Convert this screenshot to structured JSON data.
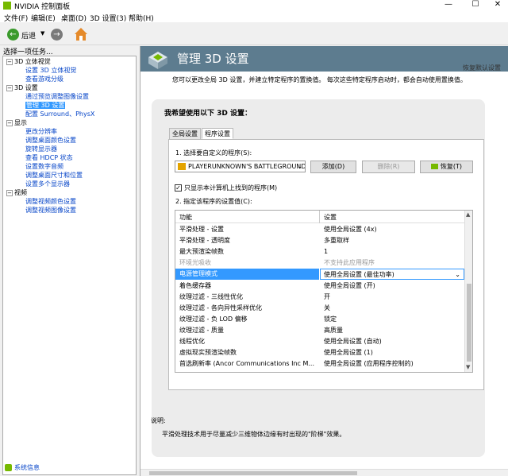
{
  "window": {
    "title": "NVIDIA 控制面板",
    "min": "—",
    "max": "☐",
    "close": "✕"
  },
  "menu": [
    "文件(F)",
    "编辑(E)",
    "桌面(D)",
    "3D 设置(3)",
    "帮助(H)"
  ],
  "toolbar": {
    "back_label": "后退",
    "back_icon": "back-arrow-icon",
    "forward_icon": "forward-arrow-icon",
    "home_icon": "home-icon"
  },
  "left": {
    "label": "选择一项任务...",
    "tree": [
      {
        "type": "cat",
        "label": "3D 立体视觉"
      },
      {
        "type": "link",
        "label": "设置 3D 立体视觉"
      },
      {
        "type": "link",
        "label": "查看游戏分级"
      },
      {
        "type": "cat",
        "label": "3D 设置"
      },
      {
        "type": "link",
        "label": "通过预览调整图像设置"
      },
      {
        "type": "sel",
        "label": "管理 3D 设置"
      },
      {
        "type": "link",
        "label": "配置 Surround、PhysX"
      },
      {
        "type": "cat",
        "label": "显示"
      },
      {
        "type": "link",
        "label": "更改分辨率"
      },
      {
        "type": "link",
        "label": "调整桌面颜色设置"
      },
      {
        "type": "link",
        "label": "旋转显示器"
      },
      {
        "type": "link",
        "label": "查看 HDCP 状态"
      },
      {
        "type": "link",
        "label": "设置数字音频"
      },
      {
        "type": "link",
        "label": "调整桌面尺寸和位置"
      },
      {
        "type": "link",
        "label": "设置多个显示器"
      },
      {
        "type": "cat",
        "label": "视频"
      },
      {
        "type": "link",
        "label": "调整视频颜色设置"
      },
      {
        "type": "link",
        "label": "调整视频图像设置"
      }
    ],
    "sysinfo": "系统信息"
  },
  "main": {
    "title": "管理 3D 设置",
    "restore_link": "恢复默认设置",
    "intro": "您可以更改全局 3D 设置，并建立特定程序的置换值。 每次这些特定程序启动时，都会自动使用置换值。",
    "panel_title": "我希望使用以下 3D 设置：",
    "tabs": [
      "全局设置",
      "程序设置"
    ],
    "step1": "1. 选择要自定义的程序(S):",
    "program": "PLAYERUNKNOWN'S BATTLEGROUNDS",
    "add_btn": "添加(D)",
    "del_btn": "删除(R)",
    "restore_btn": "恢复(T)",
    "checkbox_label": "只显示本计算机上找到的程序(M)",
    "checkbox_checked": "✓",
    "step2": "2. 指定该程序的设置值(C):",
    "grid_headers": [
      "功能",
      "设置"
    ],
    "rows": [
      {
        "feature": "平滑处理 - 设置",
        "value": "使用全局设置 (4x)",
        "state": "normal"
      },
      {
        "feature": "平滑处理 - 透明度",
        "value": "多重取样",
        "state": "normal"
      },
      {
        "feature": "最大预渲染帧数",
        "value": "1",
        "state": "normal"
      },
      {
        "feature": "环境光吸收",
        "value": "不支持此应用程序",
        "state": "disabled"
      },
      {
        "feature": "电源管理模式",
        "value": "使用全局设置 (最佳功率)",
        "state": "selected"
      },
      {
        "feature": "着色缓存器",
        "value": "使用全局设置 (开)",
        "state": "normal"
      },
      {
        "feature": "纹理过滤 - 三线性优化",
        "value": "开",
        "state": "normal"
      },
      {
        "feature": "纹理过滤 - 各向异性采样优化",
        "value": "关",
        "state": "normal"
      },
      {
        "feature": "纹理过滤 - 负 LOD 偏移",
        "value": "锁定",
        "state": "normal"
      },
      {
        "feature": "纹理过滤 - 质量",
        "value": "高质量",
        "state": "normal"
      },
      {
        "feature": "线程优化",
        "value": "使用全局设置 (自动)",
        "state": "normal"
      },
      {
        "feature": "虚拟现实预渲染帧数",
        "value": "使用全局设置 (1)",
        "state": "normal"
      },
      {
        "feature": "首选刷新率 (Ancor Communications Inc M...",
        "value": "使用全局设置 (应用程序控制的)",
        "state": "normal"
      }
    ],
    "desc_label": "说明:",
    "desc_text": "平滑处理技术用于尽量减少三维物体边缘有时出现的\"阶梯\"效果。"
  }
}
